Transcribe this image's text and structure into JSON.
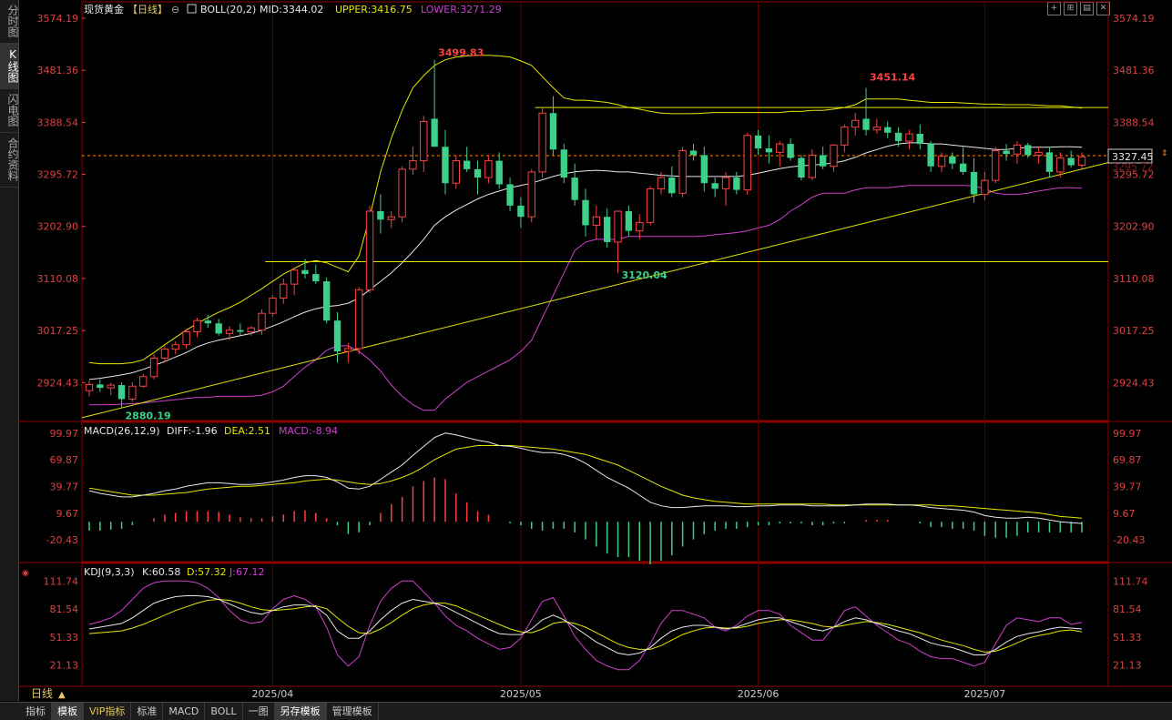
{
  "sidebar": {
    "tabs": [
      {
        "label": "分时图",
        "active": false
      },
      {
        "label": "K线图",
        "active": true
      },
      {
        "label": "闪电图",
        "active": false
      },
      {
        "label": "合约资料",
        "active": false
      }
    ]
  },
  "main_legend": {
    "instrument": "现货黄金",
    "period": "【日线】",
    "indicator": "BOLL(20,2)",
    "mid": "MID:3344.02",
    "upper": "UPPER:3416.75",
    "lower": "LOWER:3271.29"
  },
  "macd_legend": {
    "name": "MACD(26,12,9)",
    "diff": "DIFF:-1.96",
    "dea": "DEA:2.51",
    "macd": "MACD:-8.94"
  },
  "kdj_legend": {
    "name": "KDJ(9,3,3)",
    "k": "K:60.58",
    "d": "D:57.32",
    "j": "J:67.12"
  },
  "price_axis": [
    "3574.19",
    "3481.36",
    "3388.54",
    "3295.72",
    "3202.90",
    "3110.08",
    "3017.25",
    "2924.43"
  ],
  "price_axis_right_extra": "3295.72",
  "last_price": "3327.45",
  "annotations": {
    "high1": "3499.83",
    "high2": "3451.14",
    "low1": "3120.04",
    "low0": "2880.19"
  },
  "macd_axis": [
    "99.97",
    "69.87",
    "39.77",
    "9.67",
    "-20.43"
  ],
  "kdj_axis": [
    "111.74",
    "81.54",
    "51.33",
    "21.13"
  ],
  "x_axis": [
    "2025/04",
    "2025/05",
    "2025/06",
    "2025/07"
  ],
  "period_label": "日线",
  "bottom_tabs": [
    {
      "label": "指标",
      "active": false
    },
    {
      "label": "模板",
      "active": true
    },
    {
      "label": "VIP指标",
      "vip": true
    },
    {
      "label": "标准"
    },
    {
      "label": "MACD"
    },
    {
      "label": "BOLL"
    },
    {
      "label": "一图"
    },
    {
      "label": "另存模板",
      "active": true
    },
    {
      "label": "管理模板"
    }
  ],
  "toolbar_icons": [
    "crosshair-icon",
    "split-icon",
    "layout-icon",
    "close-icon"
  ],
  "colors": {
    "up": "#ff4040",
    "down": "#3cd08a",
    "ma": "#e8e8e8",
    "upper": "#e6e600",
    "lower": "#d040d0",
    "axis": "#e04040",
    "grid": "#8b0000"
  },
  "chart_data": {
    "type": "candlestick",
    "candles": [
      [
        2910,
        2928,
        2900,
        2921
      ],
      [
        2921,
        2930,
        2908,
        2915
      ],
      [
        2915,
        2924,
        2902,
        2920
      ],
      [
        2920,
        2925,
        2880,
        2895
      ],
      [
        2895,
        2925,
        2890,
        2918
      ],
      [
        2918,
        2940,
        2915,
        2935
      ],
      [
        2935,
        2975,
        2930,
        2968
      ],
      [
        2968,
        2990,
        2960,
        2984
      ],
      [
        2984,
        2998,
        2975,
        2992
      ],
      [
        2992,
        3020,
        2985,
        3015
      ],
      [
        3015,
        3040,
        3005,
        3035
      ],
      [
        3035,
        3045,
        3022,
        3030
      ],
      [
        3030,
        3038,
        3008,
        3012
      ],
      [
        3012,
        3025,
        3000,
        3018
      ],
      [
        3018,
        3030,
        3008,
        3015
      ],
      [
        3015,
        3025,
        3008,
        3022
      ],
      [
        3018,
        3055,
        3010,
        3048
      ],
      [
        3048,
        3080,
        3042,
        3075
      ],
      [
        3075,
        3110,
        3065,
        3100
      ],
      [
        3100,
        3130,
        3080,
        3125
      ],
      [
        3125,
        3145,
        3110,
        3118
      ],
      [
        3118,
        3135,
        3100,
        3105
      ],
      [
        3105,
        3112,
        3030,
        3035
      ],
      [
        3035,
        3050,
        2960,
        2980
      ],
      [
        2980,
        2995,
        2960,
        2985
      ],
      [
        2985,
        3095,
        2975,
        3090
      ],
      [
        3090,
        3240,
        3085,
        3230
      ],
      [
        3230,
        3260,
        3190,
        3215
      ],
      [
        3215,
        3230,
        3200,
        3220
      ],
      [
        3220,
        3310,
        3210,
        3305
      ],
      [
        3305,
        3345,
        3295,
        3320
      ],
      [
        3320,
        3400,
        3300,
        3390
      ],
      [
        3395,
        3500,
        3360,
        3345
      ],
      [
        3345,
        3375,
        3260,
        3280
      ],
      [
        3280,
        3330,
        3270,
        3320
      ],
      [
        3320,
        3345,
        3300,
        3305
      ],
      [
        3305,
        3320,
        3260,
        3290
      ],
      [
        3290,
        3330,
        3280,
        3320
      ],
      [
        3320,
        3335,
        3270,
        3278
      ],
      [
        3278,
        3290,
        3230,
        3240
      ],
      [
        3240,
        3255,
        3200,
        3220
      ],
      [
        3220,
        3305,
        3210,
        3300
      ],
      [
        3300,
        3415,
        3290,
        3405
      ],
      [
        3405,
        3435,
        3330,
        3340
      ],
      [
        3340,
        3350,
        3280,
        3290
      ],
      [
        3290,
        3315,
        3240,
        3250
      ],
      [
        3250,
        3270,
        3185,
        3205
      ],
      [
        3205,
        3240,
        3180,
        3220
      ],
      [
        3220,
        3235,
        3165,
        3175
      ],
      [
        3175,
        3230,
        3120,
        3230
      ],
      [
        3230,
        3240,
        3185,
        3195
      ],
      [
        3195,
        3225,
        3180,
        3210
      ],
      [
        3210,
        3275,
        3205,
        3270
      ],
      [
        3270,
        3300,
        3260,
        3290
      ],
      [
        3290,
        3310,
        3255,
        3262
      ],
      [
        3262,
        3345,
        3255,
        3338
      ],
      [
        3338,
        3350,
        3320,
        3330
      ],
      [
        3330,
        3345,
        3265,
        3280
      ],
      [
        3280,
        3290,
        3255,
        3270
      ],
      [
        3270,
        3300,
        3240,
        3290
      ],
      [
        3290,
        3300,
        3260,
        3268
      ],
      [
        3268,
        3370,
        3260,
        3365
      ],
      [
        3365,
        3375,
        3330,
        3342
      ],
      [
        3342,
        3365,
        3315,
        3335
      ],
      [
        3335,
        3355,
        3310,
        3350
      ],
      [
        3350,
        3360,
        3320,
        3325
      ],
      [
        3325,
        3330,
        3285,
        3290
      ],
      [
        3290,
        3340,
        3285,
        3330
      ],
      [
        3330,
        3345,
        3305,
        3310
      ],
      [
        3310,
        3350,
        3300,
        3348
      ],
      [
        3348,
        3385,
        3335,
        3380
      ],
      [
        3380,
        3405,
        3365,
        3392
      ],
      [
        3395,
        3450,
        3365,
        3375
      ],
      [
        3375,
        3395,
        3368,
        3380
      ],
      [
        3380,
        3390,
        3360,
        3370
      ],
      [
        3370,
        3380,
        3345,
        3355
      ],
      [
        3355,
        3375,
        3340,
        3368
      ],
      [
        3368,
        3385,
        3340,
        3350
      ],
      [
        3350,
        3355,
        3300,
        3310
      ],
      [
        3310,
        3335,
        3300,
        3328
      ],
      [
        3328,
        3335,
        3305,
        3315
      ],
      [
        3315,
        3345,
        3295,
        3300
      ],
      [
        3300,
        3325,
        3245,
        3260
      ],
      [
        3260,
        3300,
        3250,
        3285
      ],
      [
        3285,
        3345,
        3280,
        3338
      ],
      [
        3338,
        3350,
        3320,
        3332
      ],
      [
        3332,
        3355,
        3315,
        3348
      ],
      [
        3348,
        3352,
        3325,
        3330
      ],
      [
        3330,
        3345,
        3315,
        3335
      ],
      [
        3335,
        3345,
        3290,
        3300
      ],
      [
        3300,
        3335,
        3290,
        3325
      ],
      [
        3325,
        3338,
        3308,
        3312
      ],
      [
        3312,
        3335,
        3305,
        3327
      ]
    ],
    "boll_mid": [
      2930,
      2932,
      2935,
      2938,
      2942,
      2948,
      2955,
      2962,
      2970,
      2978,
      2988,
      2995,
      3000,
      3004,
      3008,
      3012,
      3018,
      3025,
      3033,
      3042,
      3050,
      3056,
      3060,
      3062,
      3066,
      3075,
      3090,
      3105,
      3120,
      3138,
      3158,
      3180,
      3205,
      3220,
      3232,
      3242,
      3252,
      3260,
      3266,
      3272,
      3276,
      3280,
      3286,
      3292,
      3297,
      3300,
      3302,
      3303,
      3302,
      3300,
      3300,
      3298,
      3296,
      3294,
      3293,
      3292,
      3292,
      3292,
      3292,
      3292,
      3292,
      3294,
      3298,
      3302,
      3306,
      3309,
      3311,
      3312,
      3314,
      3316,
      3320,
      3326,
      3334,
      3340,
      3346,
      3350,
      3352,
      3352,
      3350,
      3350,
      3348,
      3346,
      3344,
      3342,
      3340,
      3340,
      3342,
      3344,
      3344,
      3344,
      3345,
      3345,
      3344
    ],
    "boll_upper": [
      2960,
      2958,
      2958,
      2958,
      2960,
      2965,
      2978,
      2992,
      3005,
      3018,
      3030,
      3040,
      3050,
      3058,
      3068,
      3080,
      3092,
      3105,
      3118,
      3128,
      3138,
      3142,
      3138,
      3130,
      3122,
      3150,
      3220,
      3300,
      3360,
      3410,
      3450,
      3472,
      3490,
      3500,
      3505,
      3507,
      3508,
      3508,
      3507,
      3505,
      3498,
      3490,
      3470,
      3450,
      3432,
      3428,
      3428,
      3426,
      3424,
      3420,
      3415,
      3412,
      3408,
      3405,
      3404,
      3404,
      3404,
      3405,
      3406,
      3406,
      3406,
      3406,
      3406,
      3406,
      3406,
      3408,
      3408,
      3410,
      3410,
      3412,
      3415,
      3420,
      3430,
      3430,
      3430,
      3430,
      3428,
      3426,
      3424,
      3424,
      3424,
      3423,
      3422,
      3421,
      3421,
      3420,
      3420,
      3420,
      3419,
      3418,
      3418,
      3416,
      3414
    ],
    "boll_lower": [
      2885,
      2885,
      2885,
      2886,
      2887,
      2888,
      2890,
      2892,
      2894,
      2896,
      2898,
      2898,
      2900,
      2900,
      2900,
      2900,
      2902,
      2908,
      2918,
      2935,
      2952,
      2965,
      2982,
      2990,
      2990,
      2980,
      2965,
      2945,
      2920,
      2900,
      2885,
      2875,
      2875,
      2895,
      2910,
      2925,
      2935,
      2945,
      2955,
      2965,
      2980,
      3000,
      3040,
      3080,
      3120,
      3160,
      3175,
      3180,
      3180,
      3180,
      3185,
      3185,
      3185,
      3185,
      3185,
      3185,
      3185,
      3186,
      3188,
      3190,
      3192,
      3195,
      3200,
      3205,
      3215,
      3230,
      3242,
      3255,
      3262,
      3262,
      3262,
      3268,
      3272,
      3272,
      3272,
      3274,
      3276,
      3276,
      3276,
      3276,
      3276,
      3276,
      3275,
      3270,
      3262,
      3260,
      3260,
      3262,
      3266,
      3269,
      3272,
      3272,
      3271
    ],
    "resistance_line": 3415,
    "support_line": 3140,
    "trendline": {
      "from_index": 0,
      "from_value": 2865,
      "to_index": 92,
      "to_value": 3305
    },
    "macd": {
      "diff": [
        35,
        32,
        30,
        28,
        28,
        30,
        32,
        35,
        37,
        40,
        42,
        44,
        44,
        43,
        42,
        42,
        43,
        45,
        47,
        50,
        52,
        52,
        50,
        45,
        38,
        37,
        40,
        48,
        56,
        64,
        75,
        85,
        95,
        100,
        98,
        95,
        92,
        90,
        86,
        85,
        83,
        80,
        78,
        78,
        76,
        72,
        66,
        58,
        50,
        44,
        38,
        30,
        22,
        18,
        16,
        16,
        17,
        18,
        18,
        18,
        17,
        17,
        18,
        18,
        19,
        19,
        19,
        18,
        18,
        18,
        18,
        19,
        20,
        20,
        20,
        19,
        19,
        18,
        16,
        15,
        14,
        13,
        11,
        7,
        5,
        4,
        4,
        5,
        4,
        2,
        0,
        -1,
        -2
      ],
      "dea": [
        38,
        36,
        34,
        32,
        30,
        30,
        30,
        31,
        32,
        33,
        35,
        37,
        38,
        39,
        40,
        40,
        41,
        42,
        43,
        44,
        46,
        47,
        48,
        47,
        45,
        43,
        42,
        43,
        46,
        50,
        55,
        62,
        70,
        76,
        82,
        84,
        86,
        86,
        86,
        86,
        85,
        84,
        83,
        82,
        80,
        78,
        76,
        72,
        68,
        64,
        58,
        52,
        46,
        40,
        35,
        30,
        27,
        25,
        23,
        22,
        21,
        20,
        20,
        20,
        20,
        20,
        20,
        20,
        20,
        19,
        19,
        19,
        19,
        19,
        19,
        19,
        19,
        19,
        19,
        18,
        18,
        17,
        16,
        15,
        14,
        13,
        12,
        11,
        10,
        8,
        6,
        5,
        4
      ],
      "hist": [
        -10,
        -10,
        -9,
        -8,
        -4,
        0,
        4,
        8,
        10,
        12,
        12,
        12,
        11,
        8,
        5,
        4,
        4,
        6,
        8,
        12,
        13,
        10,
        4,
        -4,
        -14,
        -12,
        -4,
        10,
        20,
        28,
        40,
        46,
        50,
        48,
        32,
        22,
        12,
        8,
        0,
        -2,
        -4,
        -8,
        -10,
        -8,
        -8,
        -12,
        -20,
        -28,
        -36,
        -40,
        -40,
        -44,
        -48,
        -44,
        -38,
        -28,
        -20,
        -14,
        -10,
        -8,
        -8,
        -6,
        -4,
        -4,
        -2,
        -2,
        -2,
        -4,
        -4,
        -2,
        -2,
        0,
        2,
        2,
        2,
        0,
        0,
        -2,
        -6,
        -6,
        -8,
        -8,
        -10,
        -16,
        -18,
        -18,
        -16,
        -12,
        -12,
        -12,
        -12,
        -12,
        -12
      ]
    },
    "kdj": {
      "k": [
        60,
        62,
        64,
        66,
        72,
        80,
        88,
        92,
        95,
        96,
        96,
        95,
        92,
        87,
        82,
        78,
        76,
        80,
        84,
        86,
        86,
        84,
        75,
        58,
        50,
        50,
        58,
        70,
        80,
        88,
        92,
        90,
        88,
        84,
        78,
        72,
        66,
        60,
        55,
        54,
        54,
        60,
        70,
        75,
        70,
        62,
        54,
        46,
        40,
        34,
        32,
        34,
        40,
        50,
        58,
        62,
        64,
        64,
        62,
        60,
        62,
        66,
        70,
        72,
        72,
        68,
        64,
        60,
        58,
        62,
        68,
        72,
        70,
        66,
        62,
        58,
        55,
        50,
        45,
        42,
        40,
        36,
        32,
        32,
        38,
        46,
        52,
        55,
        57,
        60,
        62,
        61,
        60
      ],
      "d": [
        55,
        56,
        57,
        58,
        61,
        65,
        70,
        75,
        80,
        84,
        88,
        91,
        92,
        91,
        88,
        84,
        81,
        80,
        81,
        82,
        84,
        85,
        82,
        72,
        63,
        56,
        55,
        60,
        67,
        75,
        82,
        86,
        88,
        88,
        85,
        80,
        75,
        70,
        65,
        60,
        57,
        56,
        60,
        66,
        68,
        66,
        62,
        56,
        50,
        44,
        40,
        38,
        38,
        42,
        48,
        54,
        58,
        61,
        62,
        61,
        61,
        63,
        66,
        68,
        70,
        70,
        68,
        66,
        63,
        62,
        64,
        66,
        68,
        67,
        65,
        62,
        59,
        56,
        52,
        48,
        45,
        42,
        38,
        35,
        36,
        40,
        45,
        50,
        53,
        55,
        58,
        59,
        57
      ],
      "j": [
        65,
        68,
        72,
        80,
        92,
        104,
        110,
        112,
        112,
        112,
        110,
        104,
        94,
        80,
        70,
        66,
        68,
        82,
        92,
        96,
        92,
        84,
        62,
        32,
        20,
        30,
        64,
        90,
        104,
        112,
        112,
        100,
        88,
        74,
        64,
        58,
        50,
        44,
        38,
        40,
        50,
        70,
        90,
        94,
        74,
        52,
        38,
        26,
        20,
        16,
        16,
        26,
        44,
        66,
        80,
        80,
        76,
        72,
        62,
        58,
        64,
        74,
        80,
        80,
        76,
        64,
        56,
        48,
        48,
        62,
        80,
        84,
        74,
        64,
        56,
        48,
        44,
        36,
        30,
        28,
        28,
        24,
        20,
        24,
        44,
        64,
        72,
        70,
        68,
        72,
        72,
        65,
        67
      ]
    }
  }
}
